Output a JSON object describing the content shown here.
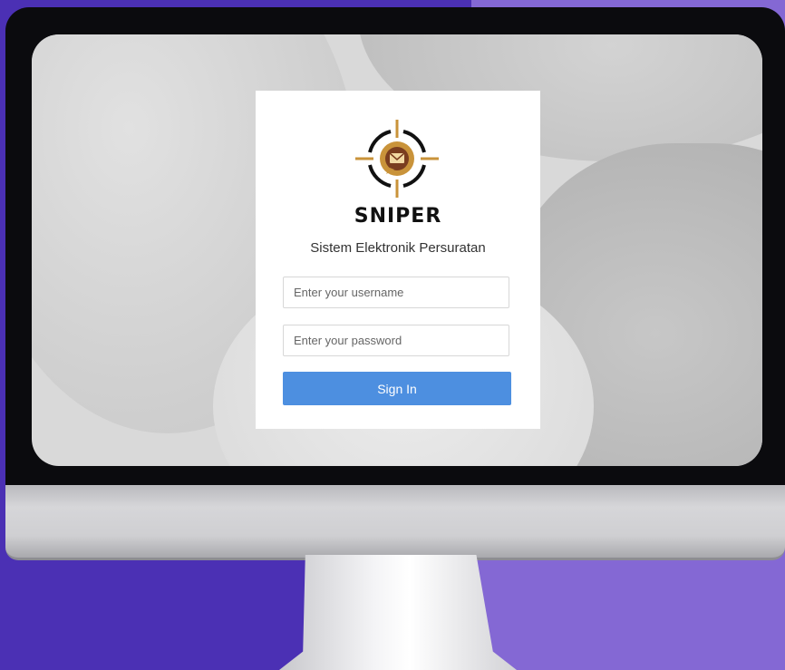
{
  "app": {
    "brand": "SNIPER",
    "subtitle": "Sistem Elektronik Persuratan",
    "logo_icon": "crosshair-envelope-icon",
    "accent_color": "#c9933a"
  },
  "form": {
    "username_placeholder": "Enter your username",
    "password_placeholder": "Enter your password",
    "submit_label": "Sign In",
    "submit_color": "#4d8fe0"
  },
  "background": {
    "left_color": "#4b30b4",
    "right_color": "#8468d4"
  }
}
